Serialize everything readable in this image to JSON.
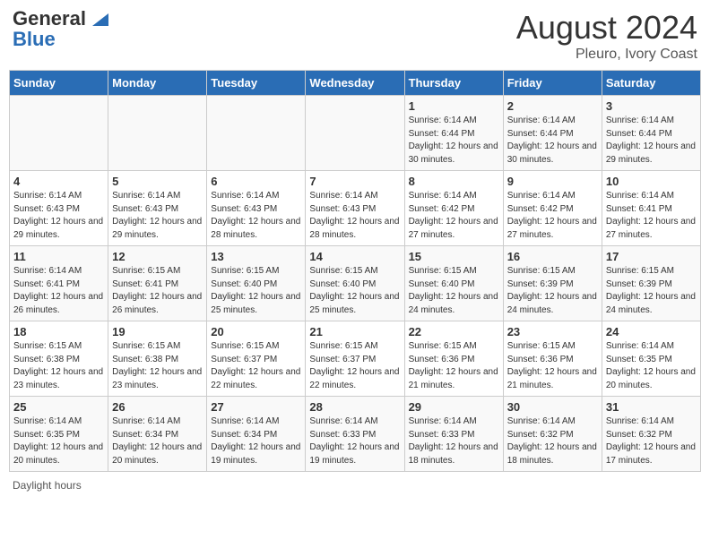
{
  "header": {
    "logo_line1": "General",
    "logo_line2": "Blue",
    "main_title": "August 2024",
    "subtitle": "Pleuro, Ivory Coast"
  },
  "days_of_week": [
    "Sunday",
    "Monday",
    "Tuesday",
    "Wednesday",
    "Thursday",
    "Friday",
    "Saturday"
  ],
  "weeks": [
    [
      {
        "day": "",
        "info": ""
      },
      {
        "day": "",
        "info": ""
      },
      {
        "day": "",
        "info": ""
      },
      {
        "day": "",
        "info": ""
      },
      {
        "day": "1",
        "info": "Sunrise: 6:14 AM\nSunset: 6:44 PM\nDaylight: 12 hours and 30 minutes."
      },
      {
        "day": "2",
        "info": "Sunrise: 6:14 AM\nSunset: 6:44 PM\nDaylight: 12 hours and 30 minutes."
      },
      {
        "day": "3",
        "info": "Sunrise: 6:14 AM\nSunset: 6:44 PM\nDaylight: 12 hours and 29 minutes."
      }
    ],
    [
      {
        "day": "4",
        "info": "Sunrise: 6:14 AM\nSunset: 6:43 PM\nDaylight: 12 hours and 29 minutes."
      },
      {
        "day": "5",
        "info": "Sunrise: 6:14 AM\nSunset: 6:43 PM\nDaylight: 12 hours and 29 minutes."
      },
      {
        "day": "6",
        "info": "Sunrise: 6:14 AM\nSunset: 6:43 PM\nDaylight: 12 hours and 28 minutes."
      },
      {
        "day": "7",
        "info": "Sunrise: 6:14 AM\nSunset: 6:43 PM\nDaylight: 12 hours and 28 minutes."
      },
      {
        "day": "8",
        "info": "Sunrise: 6:14 AM\nSunset: 6:42 PM\nDaylight: 12 hours and 27 minutes."
      },
      {
        "day": "9",
        "info": "Sunrise: 6:14 AM\nSunset: 6:42 PM\nDaylight: 12 hours and 27 minutes."
      },
      {
        "day": "10",
        "info": "Sunrise: 6:14 AM\nSunset: 6:41 PM\nDaylight: 12 hours and 27 minutes."
      }
    ],
    [
      {
        "day": "11",
        "info": "Sunrise: 6:14 AM\nSunset: 6:41 PM\nDaylight: 12 hours and 26 minutes."
      },
      {
        "day": "12",
        "info": "Sunrise: 6:15 AM\nSunset: 6:41 PM\nDaylight: 12 hours and 26 minutes."
      },
      {
        "day": "13",
        "info": "Sunrise: 6:15 AM\nSunset: 6:40 PM\nDaylight: 12 hours and 25 minutes."
      },
      {
        "day": "14",
        "info": "Sunrise: 6:15 AM\nSunset: 6:40 PM\nDaylight: 12 hours and 25 minutes."
      },
      {
        "day": "15",
        "info": "Sunrise: 6:15 AM\nSunset: 6:40 PM\nDaylight: 12 hours and 24 minutes."
      },
      {
        "day": "16",
        "info": "Sunrise: 6:15 AM\nSunset: 6:39 PM\nDaylight: 12 hours and 24 minutes."
      },
      {
        "day": "17",
        "info": "Sunrise: 6:15 AM\nSunset: 6:39 PM\nDaylight: 12 hours and 24 minutes."
      }
    ],
    [
      {
        "day": "18",
        "info": "Sunrise: 6:15 AM\nSunset: 6:38 PM\nDaylight: 12 hours and 23 minutes."
      },
      {
        "day": "19",
        "info": "Sunrise: 6:15 AM\nSunset: 6:38 PM\nDaylight: 12 hours and 23 minutes."
      },
      {
        "day": "20",
        "info": "Sunrise: 6:15 AM\nSunset: 6:37 PM\nDaylight: 12 hours and 22 minutes."
      },
      {
        "day": "21",
        "info": "Sunrise: 6:15 AM\nSunset: 6:37 PM\nDaylight: 12 hours and 22 minutes."
      },
      {
        "day": "22",
        "info": "Sunrise: 6:15 AM\nSunset: 6:36 PM\nDaylight: 12 hours and 21 minutes."
      },
      {
        "day": "23",
        "info": "Sunrise: 6:15 AM\nSunset: 6:36 PM\nDaylight: 12 hours and 21 minutes."
      },
      {
        "day": "24",
        "info": "Sunrise: 6:14 AM\nSunset: 6:35 PM\nDaylight: 12 hours and 20 minutes."
      }
    ],
    [
      {
        "day": "25",
        "info": "Sunrise: 6:14 AM\nSunset: 6:35 PM\nDaylight: 12 hours and 20 minutes."
      },
      {
        "day": "26",
        "info": "Sunrise: 6:14 AM\nSunset: 6:34 PM\nDaylight: 12 hours and 20 minutes."
      },
      {
        "day": "27",
        "info": "Sunrise: 6:14 AM\nSunset: 6:34 PM\nDaylight: 12 hours and 19 minutes."
      },
      {
        "day": "28",
        "info": "Sunrise: 6:14 AM\nSunset: 6:33 PM\nDaylight: 12 hours and 19 minutes."
      },
      {
        "day": "29",
        "info": "Sunrise: 6:14 AM\nSunset: 6:33 PM\nDaylight: 12 hours and 18 minutes."
      },
      {
        "day": "30",
        "info": "Sunrise: 6:14 AM\nSunset: 6:32 PM\nDaylight: 12 hours and 18 minutes."
      },
      {
        "day": "31",
        "info": "Sunrise: 6:14 AM\nSunset: 6:32 PM\nDaylight: 12 hours and 17 minutes."
      }
    ]
  ],
  "footer": {
    "daylight_hours": "Daylight hours"
  }
}
